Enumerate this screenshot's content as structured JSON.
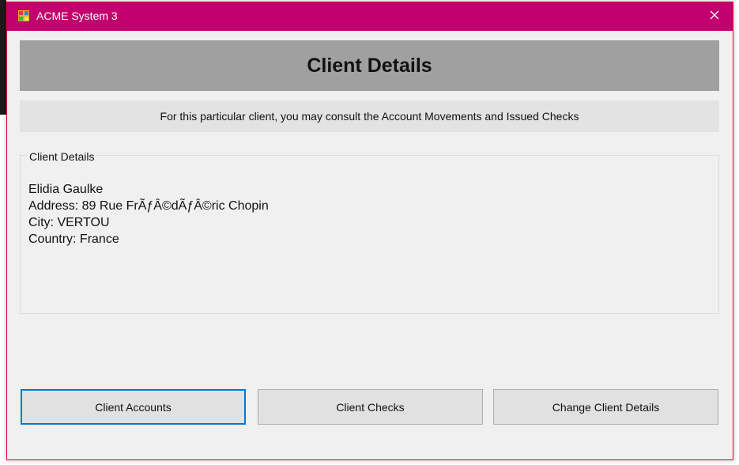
{
  "window": {
    "title": "ACME System 3",
    "titlebar_color": "#c2006e",
    "app_icon": "app-window-icon",
    "close_icon": "close-icon"
  },
  "header": {
    "title": "Client Details"
  },
  "subheader": {
    "text": "For this particular client, you may consult the Account Movements and Issued Checks"
  },
  "client_group": {
    "legend": "Client Details",
    "name": "Elidia Gaulke",
    "address": "Address: 89 Rue FrÃƒÂ©dÃƒÂ©ric Chopin",
    "city": "City: VERTOU",
    "country": "Country: France"
  },
  "buttons": {
    "accounts": "Client Accounts",
    "checks": "Client Checks",
    "change": "Change Client Details"
  },
  "colors": {
    "header_bg": "#a0a0a0",
    "subheader_bg": "#e3e3e3",
    "focus_border": "#0078d7"
  }
}
